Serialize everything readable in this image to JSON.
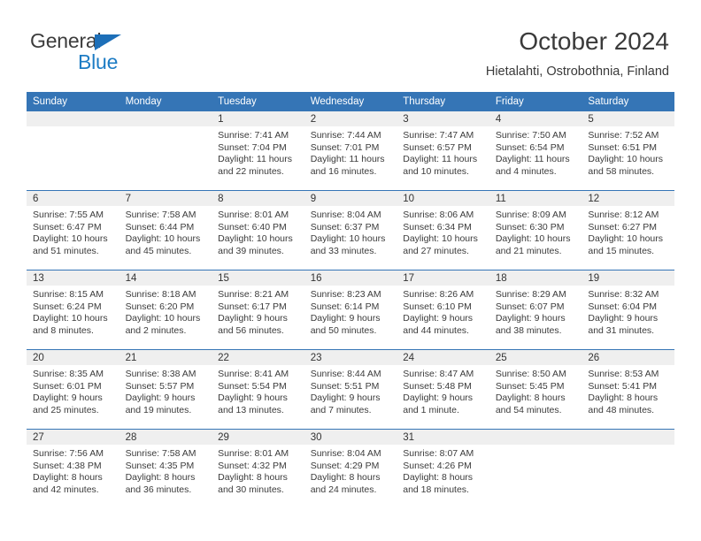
{
  "brand": {
    "name_part1": "General",
    "name_part2": "Blue",
    "triangle_icon": "triangle-icon",
    "color_dark": "#3c3c3c",
    "color_blue": "#1d7cc4"
  },
  "header": {
    "title": "October 2024",
    "location": "Hietalahti, Ostrobothnia, Finland",
    "accent_color": "#3575b6",
    "band_color": "#efefef"
  },
  "calendar": {
    "weekday_headers": [
      "Sunday",
      "Monday",
      "Tuesday",
      "Wednesday",
      "Thursday",
      "Friday",
      "Saturday"
    ],
    "weeks": [
      [
        {
          "day": "",
          "sunrise": "",
          "sunset": "",
          "daylight1": "",
          "daylight2": ""
        },
        {
          "day": "",
          "sunrise": "",
          "sunset": "",
          "daylight1": "",
          "daylight2": ""
        },
        {
          "day": "1",
          "sunrise": "Sunrise: 7:41 AM",
          "sunset": "Sunset: 7:04 PM",
          "daylight1": "Daylight: 11 hours",
          "daylight2": "and 22 minutes."
        },
        {
          "day": "2",
          "sunrise": "Sunrise: 7:44 AM",
          "sunset": "Sunset: 7:01 PM",
          "daylight1": "Daylight: 11 hours",
          "daylight2": "and 16 minutes."
        },
        {
          "day": "3",
          "sunrise": "Sunrise: 7:47 AM",
          "sunset": "Sunset: 6:57 PM",
          "daylight1": "Daylight: 11 hours",
          "daylight2": "and 10 minutes."
        },
        {
          "day": "4",
          "sunrise": "Sunrise: 7:50 AM",
          "sunset": "Sunset: 6:54 PM",
          "daylight1": "Daylight: 11 hours",
          "daylight2": "and 4 minutes."
        },
        {
          "day": "5",
          "sunrise": "Sunrise: 7:52 AM",
          "sunset": "Sunset: 6:51 PM",
          "daylight1": "Daylight: 10 hours",
          "daylight2": "and 58 minutes."
        }
      ],
      [
        {
          "day": "6",
          "sunrise": "Sunrise: 7:55 AM",
          "sunset": "Sunset: 6:47 PM",
          "daylight1": "Daylight: 10 hours",
          "daylight2": "and 51 minutes."
        },
        {
          "day": "7",
          "sunrise": "Sunrise: 7:58 AM",
          "sunset": "Sunset: 6:44 PM",
          "daylight1": "Daylight: 10 hours",
          "daylight2": "and 45 minutes."
        },
        {
          "day": "8",
          "sunrise": "Sunrise: 8:01 AM",
          "sunset": "Sunset: 6:40 PM",
          "daylight1": "Daylight: 10 hours",
          "daylight2": "and 39 minutes."
        },
        {
          "day": "9",
          "sunrise": "Sunrise: 8:04 AM",
          "sunset": "Sunset: 6:37 PM",
          "daylight1": "Daylight: 10 hours",
          "daylight2": "and 33 minutes."
        },
        {
          "day": "10",
          "sunrise": "Sunrise: 8:06 AM",
          "sunset": "Sunset: 6:34 PM",
          "daylight1": "Daylight: 10 hours",
          "daylight2": "and 27 minutes."
        },
        {
          "day": "11",
          "sunrise": "Sunrise: 8:09 AM",
          "sunset": "Sunset: 6:30 PM",
          "daylight1": "Daylight: 10 hours",
          "daylight2": "and 21 minutes."
        },
        {
          "day": "12",
          "sunrise": "Sunrise: 8:12 AM",
          "sunset": "Sunset: 6:27 PM",
          "daylight1": "Daylight: 10 hours",
          "daylight2": "and 15 minutes."
        }
      ],
      [
        {
          "day": "13",
          "sunrise": "Sunrise: 8:15 AM",
          "sunset": "Sunset: 6:24 PM",
          "daylight1": "Daylight: 10 hours",
          "daylight2": "and 8 minutes."
        },
        {
          "day": "14",
          "sunrise": "Sunrise: 8:18 AM",
          "sunset": "Sunset: 6:20 PM",
          "daylight1": "Daylight: 10 hours",
          "daylight2": "and 2 minutes."
        },
        {
          "day": "15",
          "sunrise": "Sunrise: 8:21 AM",
          "sunset": "Sunset: 6:17 PM",
          "daylight1": "Daylight: 9 hours",
          "daylight2": "and 56 minutes."
        },
        {
          "day": "16",
          "sunrise": "Sunrise: 8:23 AM",
          "sunset": "Sunset: 6:14 PM",
          "daylight1": "Daylight: 9 hours",
          "daylight2": "and 50 minutes."
        },
        {
          "day": "17",
          "sunrise": "Sunrise: 8:26 AM",
          "sunset": "Sunset: 6:10 PM",
          "daylight1": "Daylight: 9 hours",
          "daylight2": "and 44 minutes."
        },
        {
          "day": "18",
          "sunrise": "Sunrise: 8:29 AM",
          "sunset": "Sunset: 6:07 PM",
          "daylight1": "Daylight: 9 hours",
          "daylight2": "and 38 minutes."
        },
        {
          "day": "19",
          "sunrise": "Sunrise: 8:32 AM",
          "sunset": "Sunset: 6:04 PM",
          "daylight1": "Daylight: 9 hours",
          "daylight2": "and 31 minutes."
        }
      ],
      [
        {
          "day": "20",
          "sunrise": "Sunrise: 8:35 AM",
          "sunset": "Sunset: 6:01 PM",
          "daylight1": "Daylight: 9 hours",
          "daylight2": "and 25 minutes."
        },
        {
          "day": "21",
          "sunrise": "Sunrise: 8:38 AM",
          "sunset": "Sunset: 5:57 PM",
          "daylight1": "Daylight: 9 hours",
          "daylight2": "and 19 minutes."
        },
        {
          "day": "22",
          "sunrise": "Sunrise: 8:41 AM",
          "sunset": "Sunset: 5:54 PM",
          "daylight1": "Daylight: 9 hours",
          "daylight2": "and 13 minutes."
        },
        {
          "day": "23",
          "sunrise": "Sunrise: 8:44 AM",
          "sunset": "Sunset: 5:51 PM",
          "daylight1": "Daylight: 9 hours",
          "daylight2": "and 7 minutes."
        },
        {
          "day": "24",
          "sunrise": "Sunrise: 8:47 AM",
          "sunset": "Sunset: 5:48 PM",
          "daylight1": "Daylight: 9 hours",
          "daylight2": "and 1 minute."
        },
        {
          "day": "25",
          "sunrise": "Sunrise: 8:50 AM",
          "sunset": "Sunset: 5:45 PM",
          "daylight1": "Daylight: 8 hours",
          "daylight2": "and 54 minutes."
        },
        {
          "day": "26",
          "sunrise": "Sunrise: 8:53 AM",
          "sunset": "Sunset: 5:41 PM",
          "daylight1": "Daylight: 8 hours",
          "daylight2": "and 48 minutes."
        }
      ],
      [
        {
          "day": "27",
          "sunrise": "Sunrise: 7:56 AM",
          "sunset": "Sunset: 4:38 PM",
          "daylight1": "Daylight: 8 hours",
          "daylight2": "and 42 minutes."
        },
        {
          "day": "28",
          "sunrise": "Sunrise: 7:58 AM",
          "sunset": "Sunset: 4:35 PM",
          "daylight1": "Daylight: 8 hours",
          "daylight2": "and 36 minutes."
        },
        {
          "day": "29",
          "sunrise": "Sunrise: 8:01 AM",
          "sunset": "Sunset: 4:32 PM",
          "daylight1": "Daylight: 8 hours",
          "daylight2": "and 30 minutes."
        },
        {
          "day": "30",
          "sunrise": "Sunrise: 8:04 AM",
          "sunset": "Sunset: 4:29 PM",
          "daylight1": "Daylight: 8 hours",
          "daylight2": "and 24 minutes."
        },
        {
          "day": "31",
          "sunrise": "Sunrise: 8:07 AM",
          "sunset": "Sunset: 4:26 PM",
          "daylight1": "Daylight: 8 hours",
          "daylight2": "and 18 minutes."
        },
        {
          "day": "",
          "sunrise": "",
          "sunset": "",
          "daylight1": "",
          "daylight2": ""
        },
        {
          "day": "",
          "sunrise": "",
          "sunset": "",
          "daylight1": "",
          "daylight2": ""
        }
      ]
    ]
  }
}
